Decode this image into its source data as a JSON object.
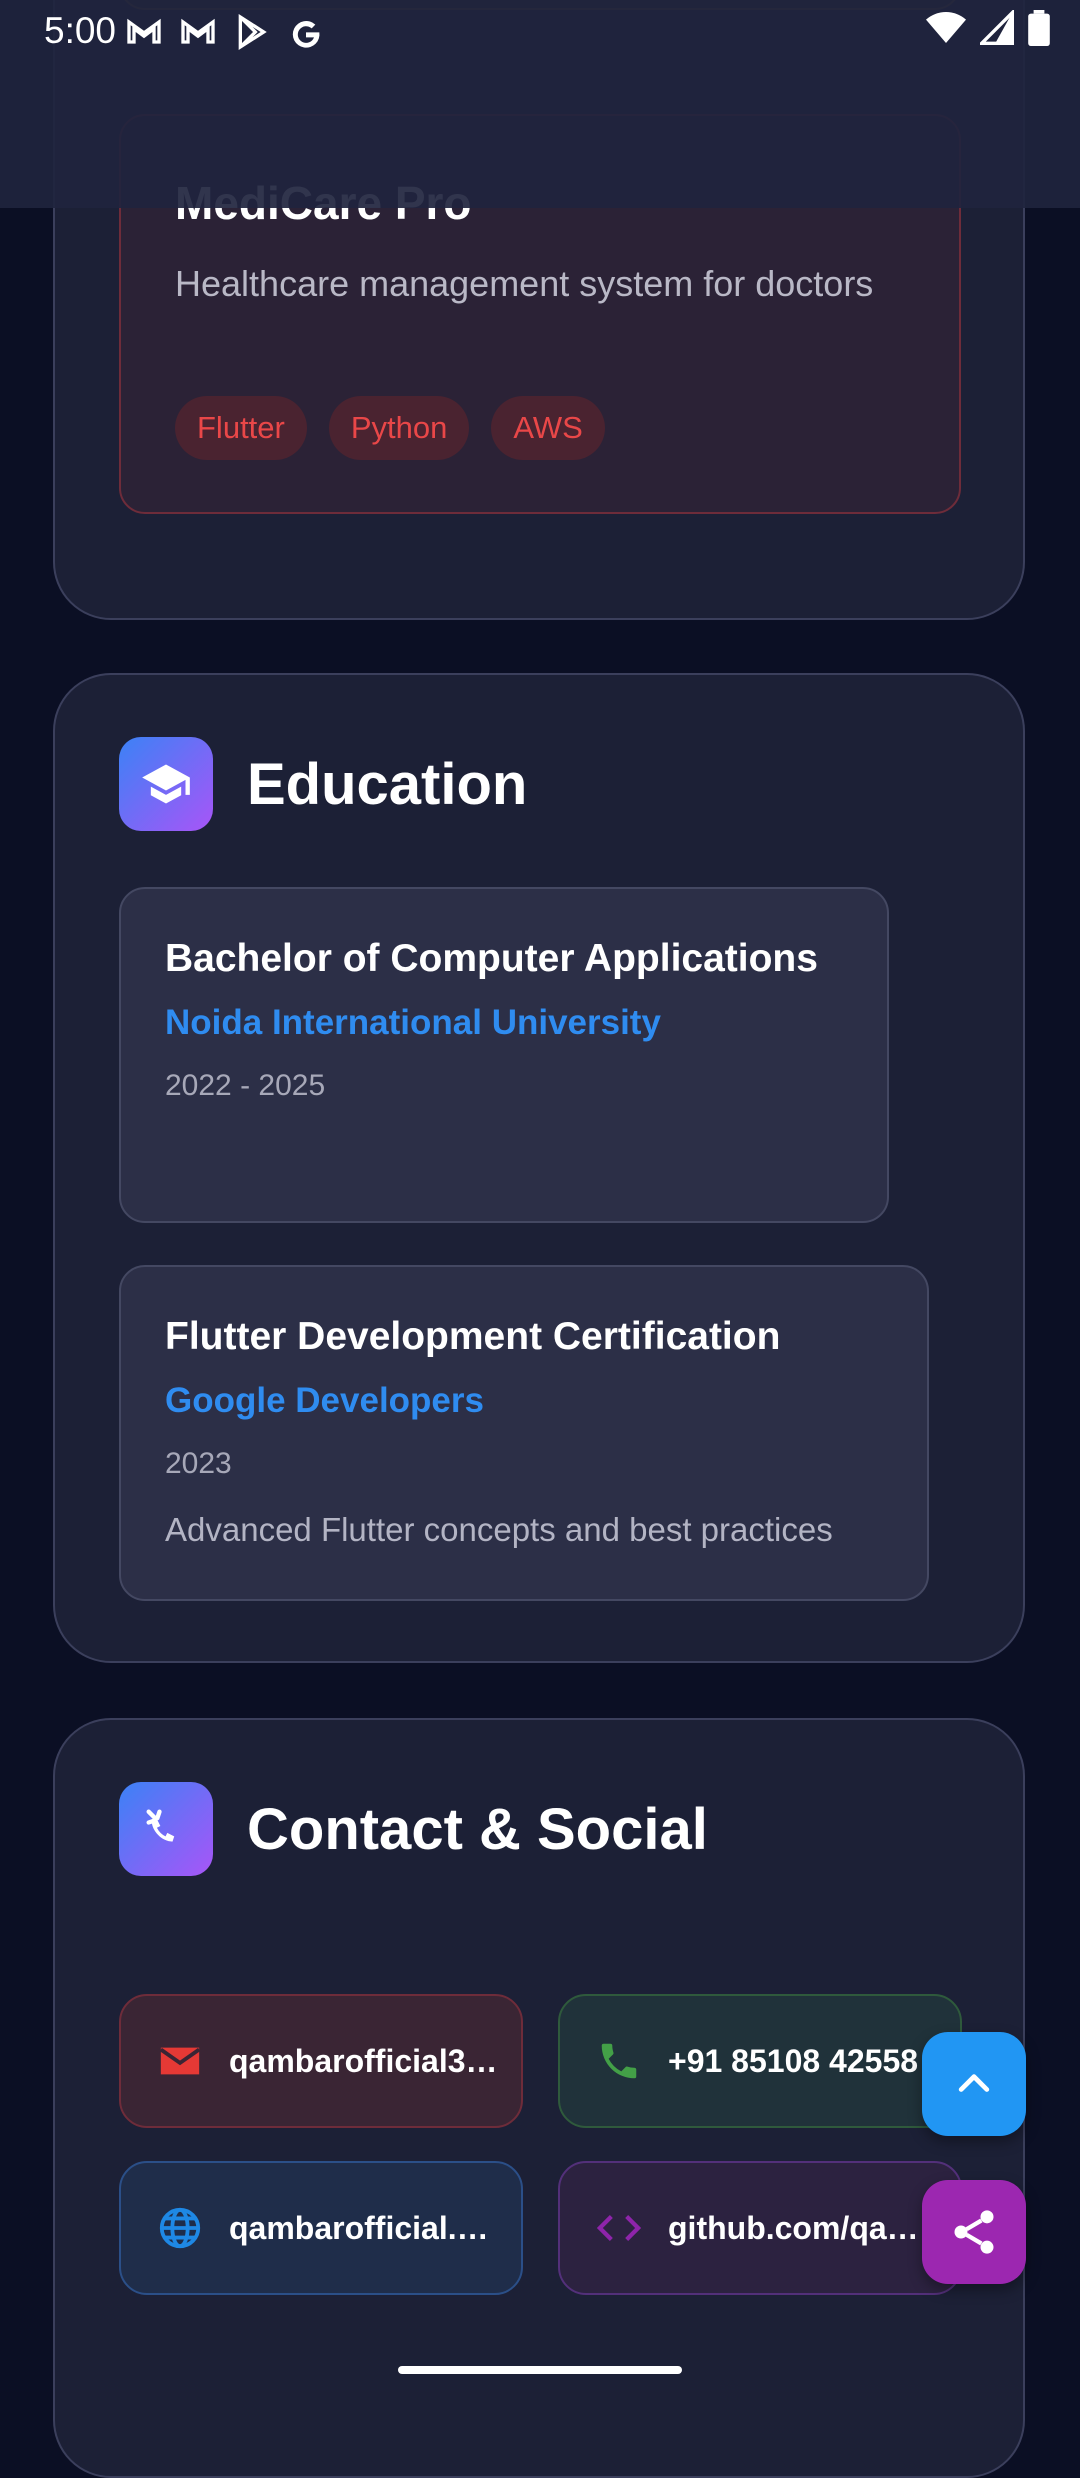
{
  "status_bar": {
    "time": "5:00",
    "left_icons": [
      "gmail-icon",
      "gmail-icon",
      "play-store-icon",
      "google-icon"
    ],
    "right_icons": [
      "wifi-icon",
      "signal-icon",
      "battery-icon"
    ]
  },
  "projects": {
    "items": [
      {
        "title": "MediCare Pro",
        "description": "Healthcare management system for doctors",
        "tags": [
          "Flutter",
          "Python",
          "AWS"
        ],
        "accent": "#e94748"
      }
    ]
  },
  "education": {
    "title": "Education",
    "icon": "graduation-cap-icon",
    "items": [
      {
        "title": "Bachelor of Computer Applications",
        "org": "Noida International University",
        "years": "2022 - 2025",
        "description": ""
      },
      {
        "title": "Flutter Development Certification",
        "org": "Google Developers",
        "years": "2023",
        "description": "Advanced Flutter concepts and best practices"
      }
    ]
  },
  "contact": {
    "title": "Contact & Social",
    "icon": "connect-icon",
    "email": "qambarofficial3…",
    "phone": "+91 85108 42558",
    "website": "qambarofficial.…",
    "github": "github.com/qa…"
  },
  "fabs": {
    "scroll_top_icon": "chevron-up-icon",
    "share_icon": "share-icon"
  },
  "colors": {
    "background": "#0b0f24",
    "card": "#1c2036",
    "link_blue": "#2f8cf0",
    "email_red": "#e53935",
    "phone_green": "#43a047",
    "web_blue": "#1e88e5",
    "github_purple": "#8e24aa"
  }
}
